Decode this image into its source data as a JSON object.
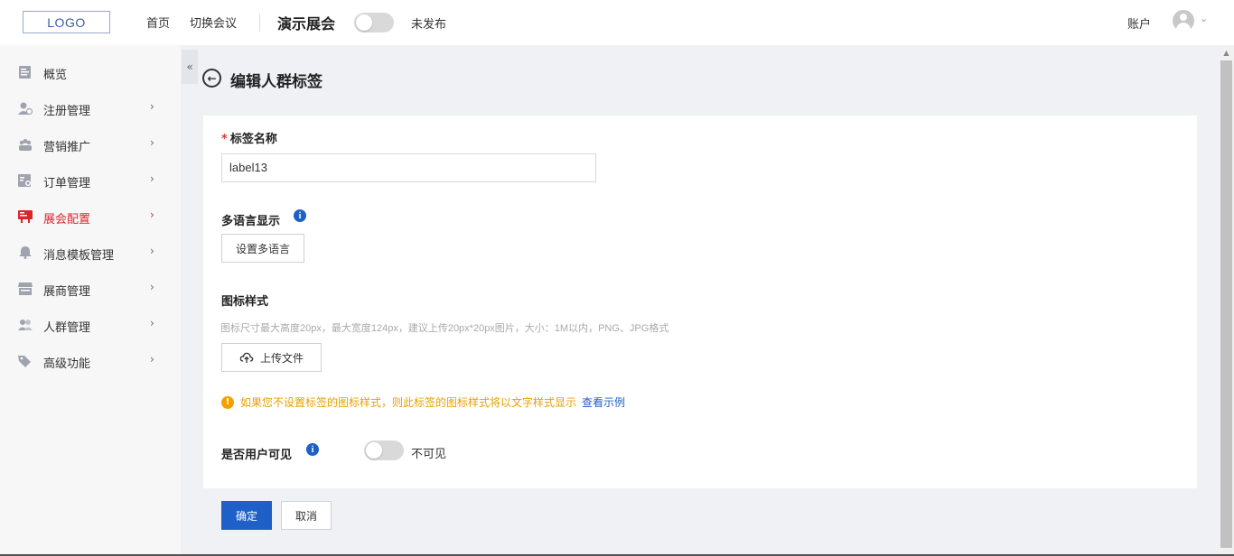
{
  "header": {
    "logo": "LOGO",
    "nav_home": "首页",
    "nav_switch": "切换会议",
    "event_title": "演示展会",
    "publish_status": "未发布",
    "publish_on": false,
    "account_label": "账户"
  },
  "sidebar": {
    "items": [
      {
        "label": "概览",
        "icon": "overview-icon",
        "has_arrow": false
      },
      {
        "label": "注册管理",
        "icon": "registration-icon",
        "has_arrow": true
      },
      {
        "label": "营销推广",
        "icon": "marketing-icon",
        "has_arrow": true
      },
      {
        "label": "订单管理",
        "icon": "order-icon",
        "has_arrow": true
      },
      {
        "label": "展会配置",
        "icon": "exhibition-config-icon",
        "has_arrow": true,
        "active": true
      },
      {
        "label": "消息模板管理",
        "icon": "bell-icon",
        "has_arrow": true
      },
      {
        "label": "展商管理",
        "icon": "store-icon",
        "has_arrow": true
      },
      {
        "label": "人群管理",
        "icon": "people-icon",
        "has_arrow": true
      },
      {
        "label": "高级功能",
        "icon": "tag-icon",
        "has_arrow": true
      }
    ],
    "collapse_glyph": "«",
    "arrow_glyph": "›"
  },
  "page": {
    "title": "编辑人群标签",
    "back_glyph": "←"
  },
  "form": {
    "name_label": "标签名称",
    "required_mark": "*",
    "name_value": "label13",
    "multilang_label": "多语言显示",
    "multilang_button": "设置多语言",
    "icon_style_label": "图标样式",
    "icon_hint": "图标尺寸最大高度20px，最大宽度124px，建议上传20px*20px图片，大小：1M以内，PNG、JPG格式",
    "upload_button": "上传文件",
    "warning_text": "如果您不设置标签的图标样式，则此标签的图标样式将以文字样式显示",
    "view_example": "查看示例",
    "visible_label": "是否用户可见",
    "visible_status": "不可见",
    "visible_on": false,
    "info_glyph": "i",
    "warn_glyph": "!"
  },
  "actions": {
    "confirm": "确定",
    "cancel": "取消"
  },
  "colors": {
    "primary": "#1f5fc8",
    "active_nav": "#d9262b",
    "warning": "#f5a000"
  }
}
